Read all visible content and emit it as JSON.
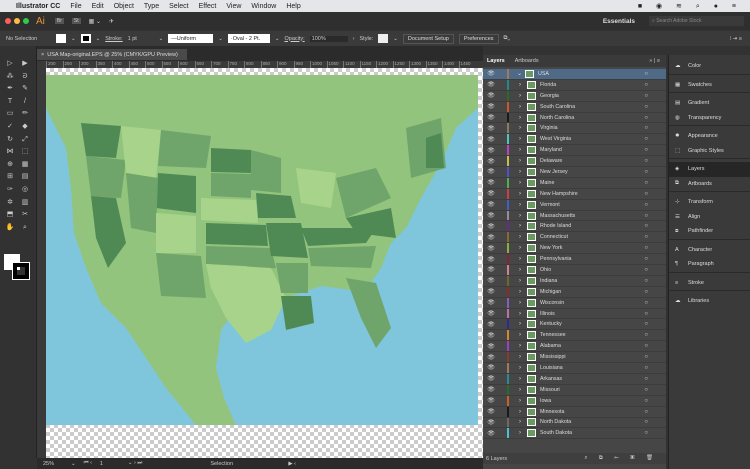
{
  "menubar": {
    "app": "Illustrator CC",
    "items": [
      "File",
      "Edit",
      "Object",
      "Type",
      "Select",
      "Effect",
      "View",
      "Window",
      "Help"
    ]
  },
  "appbar": {
    "logo": "Ai",
    "bridge": "Br",
    "stock": "St",
    "workspace": "Essentials",
    "search_placeholder": "Search Adobe Stock"
  },
  "control": {
    "selection": "No Selection",
    "stroke_label": "Stroke:",
    "stroke_value": "1 pt",
    "profile": "Uniform",
    "brush": "Oval - 2 Pt.",
    "opacity_label": "Opacity:",
    "opacity_value": "100%",
    "style_label": "Style:",
    "document_setup": "Document Setup",
    "preferences": "Preferences"
  },
  "document": {
    "tab": "USA Map-original.EPS @ 25% (CMYK/GPU Preview)",
    "ruler": [
      "200",
      "250",
      "300",
      "350",
      "400",
      "450",
      "500",
      "550",
      "600",
      "650",
      "700",
      "750",
      "800",
      "850",
      "900",
      "950",
      "1000",
      "1050",
      "1100",
      "1150",
      "1200",
      "1250",
      "1300",
      "1350",
      "1400",
      "1450"
    ]
  },
  "status": {
    "zoom": "25%",
    "artboard": "1",
    "tool": "Selection"
  },
  "layers_panel": {
    "tabs": [
      "Layers",
      "Artboards"
    ],
    "top_layer": "USA",
    "sublayers": [
      "Florida",
      "Georgia",
      "South Carolina",
      "North Carolina",
      "Virginia",
      "West Virginia",
      "Maryland",
      "Delaware",
      "New Jersey",
      "Maine",
      "New Hampshire",
      "Vermont",
      "Massachusetts",
      "Rhode Island",
      "Connecticut",
      "New York",
      "Pennsylvania",
      "Ohio",
      "Indiana",
      "Michigan",
      "Wisconsin",
      "Illinois",
      "Kentucky",
      "Tennessee",
      "Alabama",
      "Mississippi",
      "Louisiana",
      "Arkansas",
      "Missouri",
      "Iowa",
      "Minnesota",
      "North Dakota",
      "South Dakota"
    ],
    "colors": [
      "#1e8a8a",
      "#2a6a2a",
      "#d0562a",
      "#1a1a1a",
      "#8a7a6a",
      "#4ac8c0",
      "#c040c0",
      "#c8c040",
      "#5050c8",
      "#50b050",
      "#c84040",
      "#4060c8",
      "#9a8a9a",
      "#6a2a8a",
      "#8a6a2a",
      "#8ab040",
      "#8a2040",
      "#d08090",
      "#6a6a2a",
      "#8a2a2a",
      "#8060c0",
      "#c070a0",
      "#2a2a9a",
      "#d08a2a",
      "#9a40c0",
      "#8a3a2a",
      "#a07a60",
      "#2a8a9a",
      "#2a6a2a",
      "#c8602a",
      "#1a1a1a",
      "#6a6a6a",
      "#4ac0d0"
    ],
    "footer": "6 Layers"
  },
  "dock": {
    "groups": [
      [
        "Color"
      ],
      [
        "Swatches"
      ],
      [
        "Gradient",
        "Transparency"
      ],
      [
        "Appearance",
        "Graphic Styles"
      ],
      [
        "Layers",
        "Artboards"
      ],
      [
        "Transform",
        "Align",
        "Pathfinder"
      ],
      [
        "Character",
        "Paragraph"
      ],
      [
        "Stroke"
      ],
      [
        "Libraries"
      ]
    ],
    "active": "Layers"
  },
  "colors": {
    "ocean": "#7fc6dc",
    "land": "#93c47d",
    "state_dark": "#4f8a55",
    "state_mid": "#6fa56a",
    "state_light": "#a7d48a",
    "selection": "#4f6a86"
  }
}
